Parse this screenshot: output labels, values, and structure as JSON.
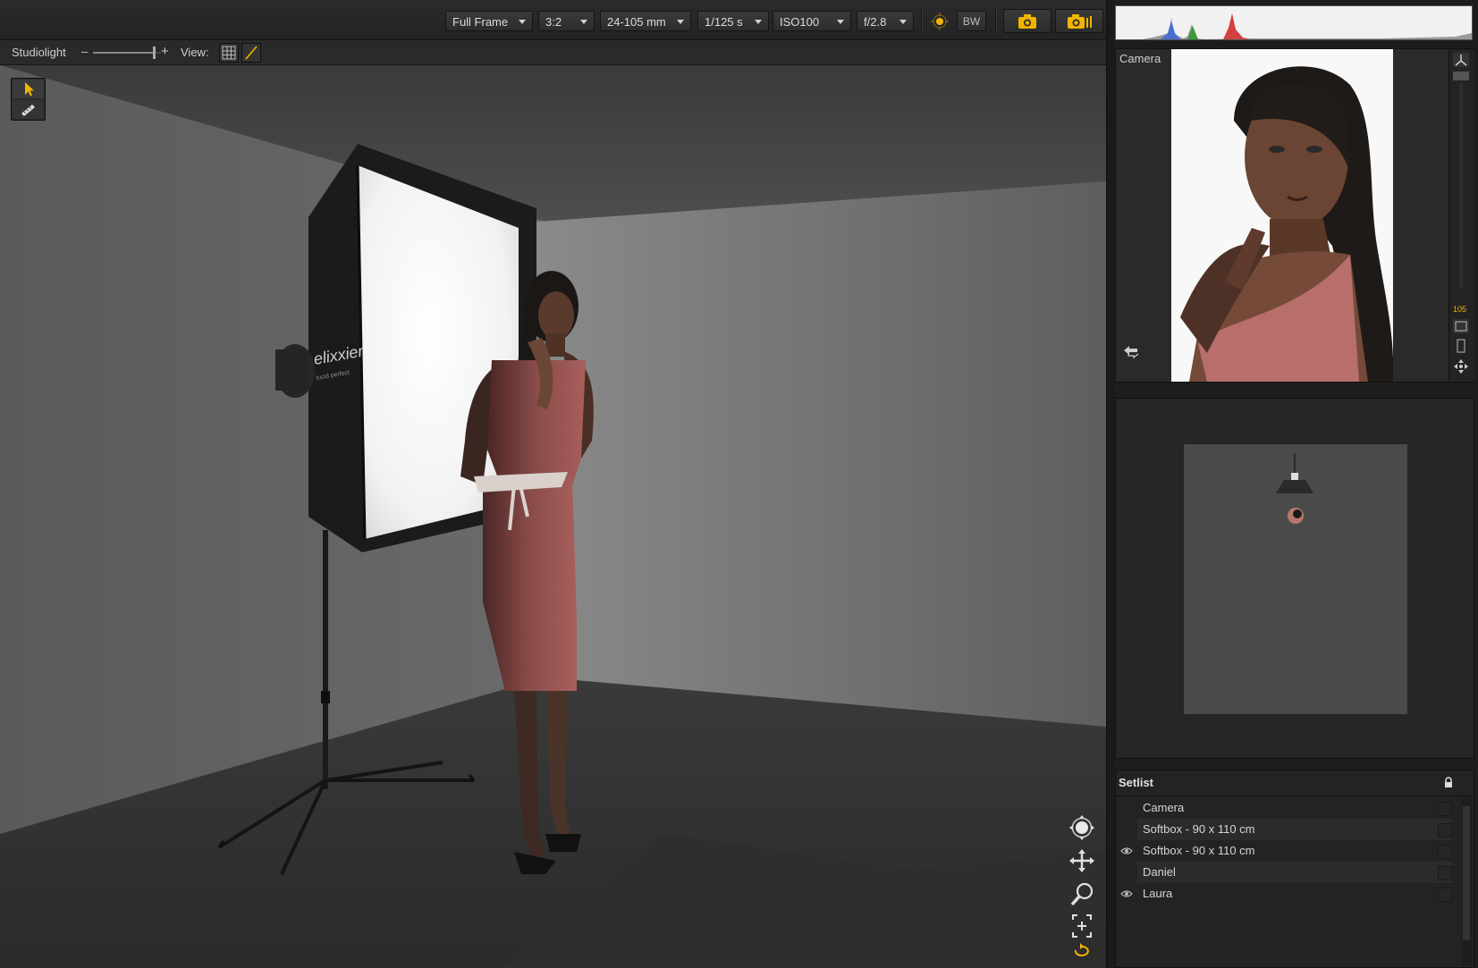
{
  "toolbar": {
    "sensor": "Full Frame",
    "aspect": "3:2",
    "lens": "24-105 mm",
    "shutter": "1/125 s",
    "iso": "ISO100",
    "aperture": "f/2.8",
    "bw_label": "BW",
    "icons": [
      "light-sun-icon",
      "camera-icon",
      "camera-series-icon"
    ]
  },
  "subbar": {
    "studiolight_label": "Studiolight",
    "minus": "–",
    "plus": "+",
    "studiolight_level": 0.9,
    "view_label": "View:"
  },
  "viewport": {
    "softbox_brand": "elixxier",
    "softbox_tagline": "lucid perfect",
    "tools": [
      "pointer-icon",
      "ruler-icon"
    ],
    "nav_icons": [
      "orbit-icon",
      "pan-icon",
      "zoom-icon",
      "fit-icon",
      "reset-icon"
    ]
  },
  "camera_panel": {
    "title": "Camera",
    "zoom_value": "105"
  },
  "setlist": {
    "title": "Setlist",
    "items": [
      {
        "label": "Camera",
        "visible": false
      },
      {
        "label": "Softbox - 90 x 110 cm",
        "visible": false
      },
      {
        "label": "Softbox - 90 x 110 cm",
        "visible": true
      },
      {
        "label": "Daniel",
        "visible": false
      },
      {
        "label": "Laura",
        "visible": true
      }
    ]
  },
  "colors": {
    "accent": "#f0b400",
    "dress": "#a85f5c",
    "panel": "#2a2a2a"
  }
}
